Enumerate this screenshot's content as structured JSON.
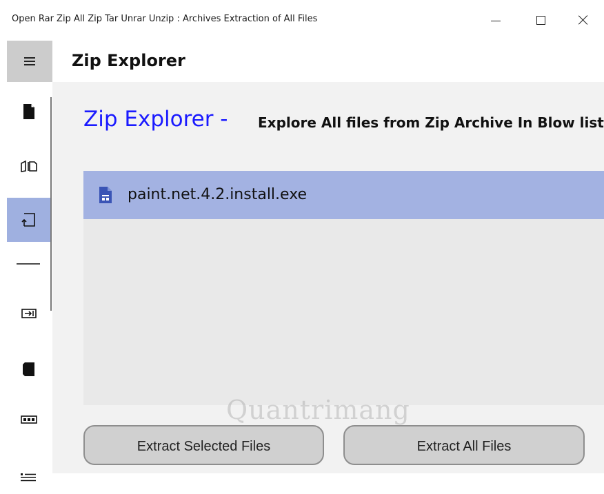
{
  "window": {
    "title": "Open Rar Zip All Zip Tar Unrar Unzip : Archives Extraction of All Files"
  },
  "header": {
    "title": "Zip Explorer"
  },
  "sidebar": {
    "items": [
      {
        "icon": "document-icon",
        "selected": false
      },
      {
        "icon": "open-book-icon",
        "selected": false
      },
      {
        "icon": "extract-icon",
        "selected": true
      },
      {
        "icon": "divider-line-icon",
        "selected": false
      },
      {
        "icon": "import-icon",
        "selected": false
      },
      {
        "icon": "folded-page-icon",
        "selected": false
      },
      {
        "icon": "rename-box-icon",
        "selected": false
      },
      {
        "icon": "list-icon",
        "selected": false
      }
    ]
  },
  "main": {
    "title": "Zip Explorer -",
    "subtitle": "Explore All files from Zip Archive In Blow list",
    "files": [
      {
        "name": "paint.net.4.2.install.exe",
        "selected": true
      }
    ],
    "buttons": {
      "extract_selected": "Extract Selected Files",
      "extract_all": "Extract All Files"
    }
  },
  "watermark": "Quantrimang",
  "colors": {
    "accent_title": "#1a1aff",
    "selection": "#a3b2e2",
    "sidebar_selected": "#9fb0e0"
  }
}
